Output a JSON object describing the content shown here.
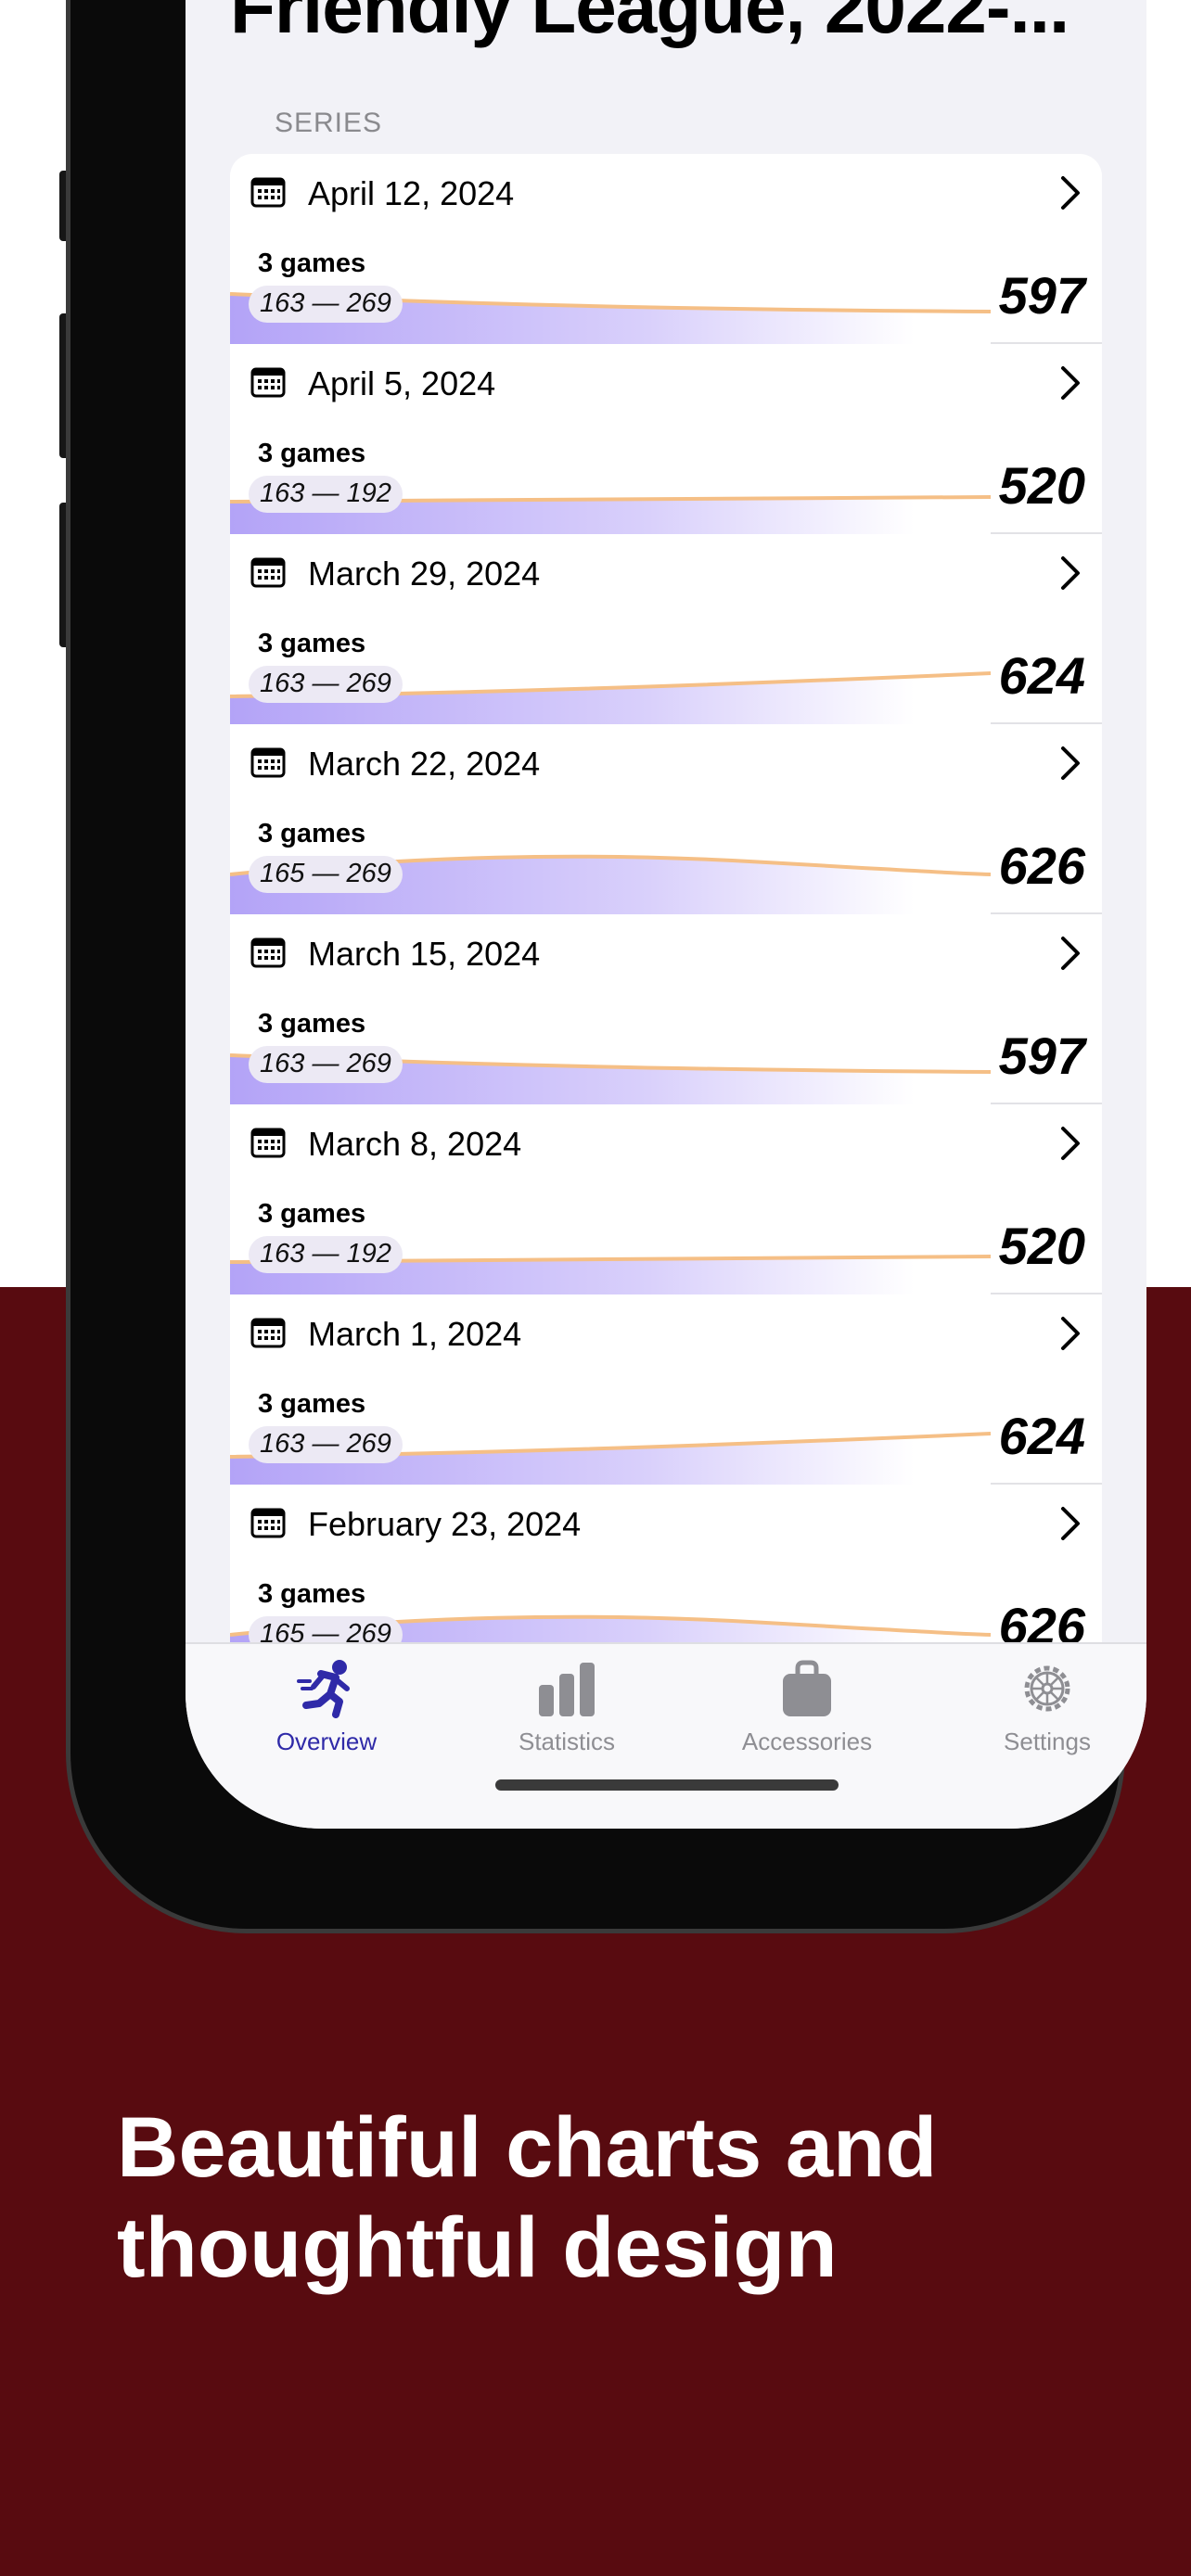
{
  "header": {
    "title": "Friendly League, 2022-..."
  },
  "section": {
    "label": "SERIES"
  },
  "series": [
    {
      "date": "April 12, 2024",
      "games": "3 games",
      "range": "163 — 269",
      "total": "597"
    },
    {
      "date": "April 5, 2024",
      "games": "3 games",
      "range": "163 — 192",
      "total": "520"
    },
    {
      "date": "March 29, 2024",
      "games": "3 games",
      "range": "163 — 269",
      "total": "624"
    },
    {
      "date": "March 22, 2024",
      "games": "3 games",
      "range": "165 — 269",
      "total": "626"
    },
    {
      "date": "March 15, 2024",
      "games": "3 games",
      "range": "163 — 269",
      "total": "597"
    },
    {
      "date": "March 8, 2024",
      "games": "3 games",
      "range": "163 — 192",
      "total": "520"
    },
    {
      "date": "March 1, 2024",
      "games": "3 games",
      "range": "163 — 269",
      "total": "624"
    },
    {
      "date": "February 23, 2024",
      "games": "3 games",
      "range": "165 — 269",
      "total": "626"
    }
  ],
  "tabbar": {
    "tabs": [
      {
        "label": "Overview",
        "icon": "runner-icon",
        "active": true
      },
      {
        "label": "Statistics",
        "icon": "bar-chart-icon",
        "active": false
      },
      {
        "label": "Accessories",
        "icon": "bag-icon",
        "active": false
      },
      {
        "label": "Settings",
        "icon": "gear-icon",
        "active": false
      }
    ]
  },
  "colors": {
    "accent": "#2f2aa8",
    "chart_fill": "#b3a3f7",
    "chart_line": "#f5bf86",
    "promo_background": "#580b10"
  },
  "promo": {
    "line1": "Beautiful charts and",
    "line2": "thoughtful design"
  }
}
